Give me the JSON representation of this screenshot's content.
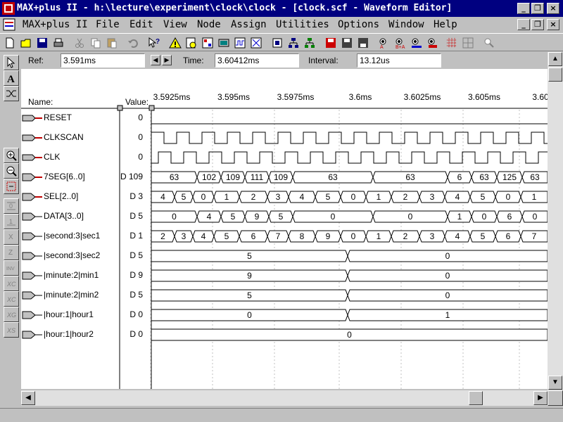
{
  "window": {
    "title": "MAX+plus II - h:\\lecture\\experiment\\clock\\clock - [clock.scf - Waveform Editor]",
    "min_glyph": "_",
    "restore_glyph": "❐",
    "close_glyph": "×"
  },
  "menu": [
    "MAX+plus II",
    "File",
    "Edit",
    "View",
    "Node",
    "Assign",
    "Utilities",
    "Options",
    "Window",
    "Help"
  ],
  "toolbar_icons": [
    "new-file-icon",
    "open-file-icon",
    "save-icon",
    "print-icon",
    "cut-icon",
    "copy-icon",
    "paste-icon",
    "undo-icon",
    "help-pointer-icon",
    "warning-icon",
    "hierarchy-icon",
    "floorplan-icon",
    "compiler-icon",
    "simulator-icon",
    "timing-icon",
    "programmer-icon",
    "project-save-icon",
    "project-save-check-icon",
    "project-save-compile-icon",
    "project-save-simulate-icon",
    "find-node-icon",
    "find-next-icon",
    "find-prev-icon",
    "find-all-icon",
    "grid-icon",
    "zoom-fit-icon"
  ],
  "ref_bar": {
    "ref_label": "Ref:",
    "ref_value": "3.591ms",
    "time_label": "Time:",
    "time_value": "3.60412ms",
    "interval_label": "Interval:",
    "interval_value": "13.12us"
  },
  "columns": {
    "name": "Name:",
    "value": "Value:"
  },
  "time_axis": {
    "labels": [
      "3.5925ms",
      "3.595ms",
      "3.5975ms",
      "3.6ms",
      "3.6025ms",
      "3.605ms",
      "3.60"
    ]
  },
  "signals": [
    {
      "name": "RESET",
      "value": "0",
      "kind": "input"
    },
    {
      "name": "CLKSCAN",
      "value": "0",
      "kind": "input"
    },
    {
      "name": "CLK",
      "value": "0",
      "kind": "input"
    },
    {
      "name": "7SEG[6..0]",
      "value": "D 109",
      "kind": "output-bus"
    },
    {
      "name": "SEL[2..0]",
      "value": "D 3",
      "kind": "output-bus"
    },
    {
      "name": "DATA[3..0]",
      "value": "D 5",
      "kind": "buried"
    },
    {
      "name": "|second:3|sec1",
      "value": "D 1",
      "kind": "buried"
    },
    {
      "name": "|second:3|sec2",
      "value": "D 5",
      "kind": "buried"
    },
    {
      "name": "|minute:2|min1",
      "value": "D 9",
      "kind": "buried"
    },
    {
      "name": "|minute:2|min2",
      "value": "D 5",
      "kind": "buried"
    },
    {
      "name": "|hour:1|hour1",
      "value": "D 0",
      "kind": "buried"
    },
    {
      "name": "|hour:1|hour2",
      "value": "D 0",
      "kind": "buried"
    }
  ],
  "bus_segments": {
    "7SEG[6..0]": [
      "63",
      "102",
      "109",
      "111",
      "109",
      "63",
      "63",
      "6",
      "63",
      "125",
      "63"
    ],
    "SEL[2..0]": [
      "4",
      "5",
      "0",
      "1",
      "2",
      "3",
      "4",
      "5",
      "0",
      "1",
      "2",
      "3",
      "4",
      "5",
      "0",
      "1"
    ],
    "DATA[3..0]": [
      "0",
      "4",
      "5",
      "9",
      "5",
      "0",
      "0",
      "1",
      "0",
      "6",
      "0"
    ],
    "|second:3|sec1": [
      "2",
      "3",
      "4",
      "5",
      "6",
      "7",
      "8",
      "9",
      "0",
      "1",
      "2",
      "3",
      "4",
      "5",
      "6",
      "7"
    ],
    "|second:3|sec2": [
      "5",
      "0"
    ],
    "|minute:2|min1": [
      "9",
      "0"
    ],
    "|minute:2|min2": [
      "5",
      "0"
    ],
    "|hour:1|hour1": [
      "0",
      "1"
    ],
    "|hour:1|hour2": [
      "0"
    ]
  },
  "scroll": {
    "up": "▲",
    "down": "▼",
    "left": "◀",
    "right": "▶"
  }
}
